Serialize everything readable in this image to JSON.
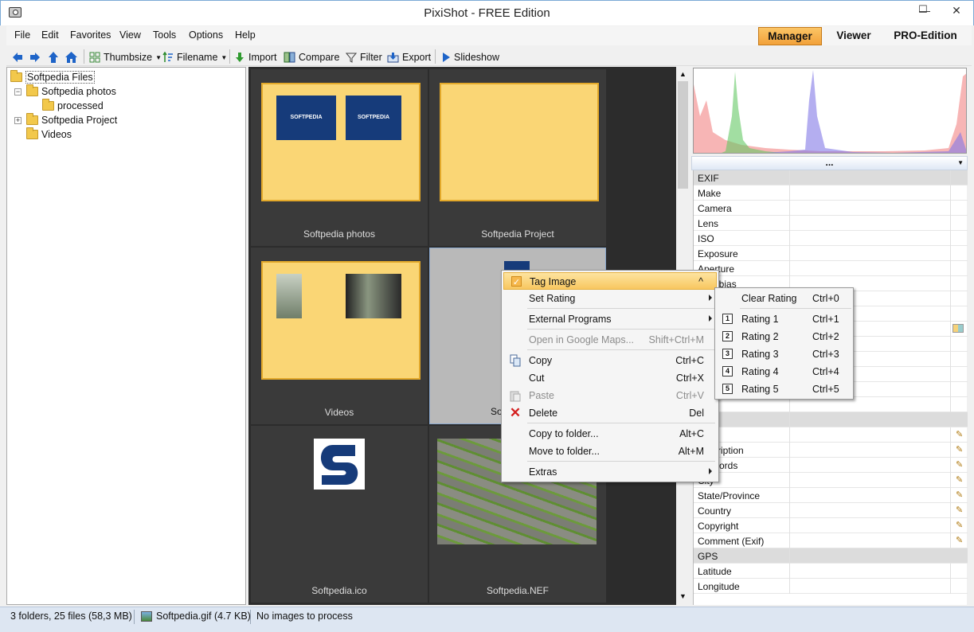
{
  "window": {
    "title": "PixiShot  -  FREE Edition",
    "minimize": "—",
    "maximize": "☐",
    "close": "✕"
  },
  "menubar": {
    "items": [
      "File",
      "Edit",
      "Favorites",
      "View",
      "Tools",
      "Options",
      "Help"
    ]
  },
  "modes": {
    "manager": "Manager",
    "viewer": "Viewer",
    "pro": "PRO-Edition"
  },
  "toolbar": {
    "thumbsize": "Thumbsize",
    "filename": "Filename",
    "import": "Import",
    "compare": "Compare",
    "filter": "Filter",
    "export": "Export",
    "slideshow": "Slideshow"
  },
  "tree": {
    "root": "Softpedia Files",
    "photos": "Softpedia photos",
    "processed": "processed",
    "project": "Softpedia Project",
    "videos": "Videos"
  },
  "thumbs": {
    "photos": "Softpedia photos",
    "project": "Softpedia Project",
    "videos": "Videos",
    "gif": "So",
    "ico": "Softpedia.ico",
    "nef": "Softpedia.NEF",
    "logo_text": "SOFTPEDIA"
  },
  "properties": {
    "more": "...",
    "rows": [
      "EXIF",
      "Make",
      "Camera",
      "Lens",
      "ISO",
      "Exposure",
      "Aperture",
      "sure bias"
    ],
    "lower_rows": [
      "",
      "ription",
      "ords",
      "City",
      "State/Province",
      "Country",
      "Copyright",
      "Comment (Exif)",
      "GPS",
      "Latitude",
      "Longitude"
    ]
  },
  "context_menu": {
    "tag": "Tag Image",
    "tag_shortcut": "^",
    "rating": "Set Rating",
    "external": "External Programs",
    "maps": "Open in Google Maps...",
    "maps_shortcut": "Shift+Ctrl+M",
    "copy": "Copy",
    "copy_shortcut": "Ctrl+C",
    "cut": "Cut",
    "cut_shortcut": "Ctrl+X",
    "paste": "Paste",
    "paste_shortcut": "Ctrl+V",
    "delete": "Delete",
    "delete_shortcut": "Del",
    "copy_to": "Copy to folder...",
    "copy_to_shortcut": "Alt+C",
    "move_to": "Move to folder...",
    "move_to_shortcut": "Alt+M",
    "extras": "Extras"
  },
  "rating_menu": {
    "clear": "Clear Rating",
    "clear_shortcut": "Ctrl+0",
    "items": [
      {
        "num": "1",
        "label": "Rating 1",
        "shortcut": "Ctrl+1"
      },
      {
        "num": "2",
        "label": "Rating 2",
        "shortcut": "Ctrl+2"
      },
      {
        "num": "3",
        "label": "Rating 3",
        "shortcut": "Ctrl+3"
      },
      {
        "num": "4",
        "label": "Rating 4",
        "shortcut": "Ctrl+4"
      },
      {
        "num": "5",
        "label": "Rating 5",
        "shortcut": "Ctrl+5"
      }
    ]
  },
  "status": {
    "summary": "3 folders,  25 files (58,3 MB)",
    "file": "Softpedia.gif  (4.7 KB)",
    "process": "No images to process"
  },
  "colors": {
    "accent": "#f6b94e",
    "thumb_bg": "#2c2c2c",
    "folder_fill": "#fad675"
  }
}
